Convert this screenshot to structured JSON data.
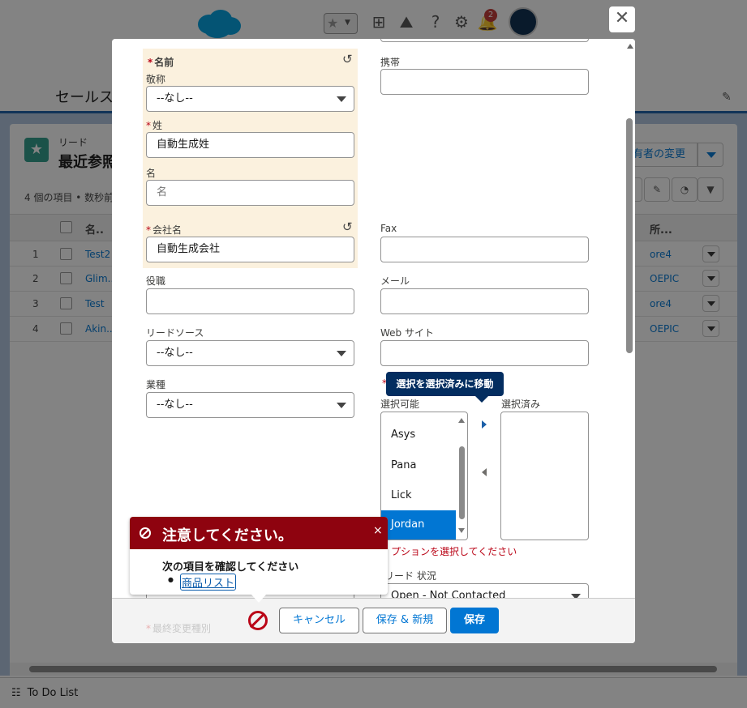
{
  "header": {
    "notification_count": "2"
  },
  "nav": {
    "app_name": "セールス"
  },
  "list_view": {
    "object_name": "リード",
    "view_name": "最近参照",
    "item_count": "4 個の項目 • 数秒前",
    "owner_change_button": "有者の変更",
    "columns": [
      "名..",
      "所..."
    ],
    "rows": [
      {
        "num": "1",
        "name": "Test2",
        "owner": "ore4"
      },
      {
        "num": "2",
        "name": "Glim...",
        "owner": "OEPIC"
      },
      {
        "num": "3",
        "name": "Test",
        "owner": "ore4"
      },
      {
        "num": "4",
        "name": "Akin...",
        "owner": "OEPIC"
      }
    ]
  },
  "close_button": "✕",
  "form": {
    "name_label": "名前",
    "salutation_label": "敬称",
    "salutation_value": "--なし--",
    "lastname_label": "姓",
    "lastname_value": "自動生成姓",
    "firstname_label": "名",
    "firstname_placeholder": "名",
    "company_label": "会社名",
    "company_value": "自動生成会社",
    "mobile_label": "携帯",
    "fax_label": "Fax",
    "title_label": "役職",
    "email_label": "メール",
    "lead_source_label": "リードソース",
    "lead_source_value": "--なし--",
    "website_label": "Web サイト",
    "industry_label": "業種",
    "industry_value": "--なし--",
    "required_mark": "*",
    "listbox_tooltip": "選択を選択済みに移動",
    "available_label": "選択可能",
    "selected_label": "選択済み",
    "available_options": [
      "Asys",
      "Pana",
      "Lick",
      "Jordan"
    ],
    "selected_option": "Jordan",
    "listbox_error": "プションを選択してください",
    "lead_status_label": "リード 状況",
    "lead_status_value": "Open - Not Contacted",
    "last_changed_label": "最終変更種別"
  },
  "footer": {
    "cancel": "キャンセル",
    "save_new": "保存 & 新規",
    "save": "保存"
  },
  "error_popover": {
    "title": "注意してください。",
    "close": "×",
    "subtitle": "次の項目を確認してください",
    "field_link": "商品リスト"
  },
  "utility_bar": {
    "todo_label": "To Do List"
  },
  "colors": {
    "brand": "#0176d3",
    "error_header": "#8e030f",
    "error_text": "#ba0517",
    "tooltip": "#032d60",
    "name_group_bg": "#fbf1de"
  }
}
